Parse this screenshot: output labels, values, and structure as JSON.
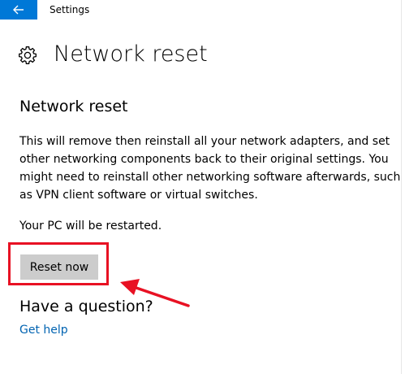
{
  "window": {
    "title": "Settings"
  },
  "page": {
    "title": "Network reset",
    "icon": "gear-icon"
  },
  "section": {
    "heading": "Network reset",
    "description_lines": [
      "This will remove then reinstall all your network adapters, and set",
      "other networking components back to their original settings. You",
      "might need to reinstall other networking software afterwards, such",
      "as VPN client software or virtual switches."
    ],
    "restart_note": "Your PC will be restarted.",
    "reset_button_label": "Reset now"
  },
  "help": {
    "heading": "Have a question?",
    "link_label": "Get help"
  },
  "colors": {
    "accent": "#0078d7",
    "link": "#0063b1",
    "button_bg": "#cccccc",
    "annotation": "#e81123"
  }
}
